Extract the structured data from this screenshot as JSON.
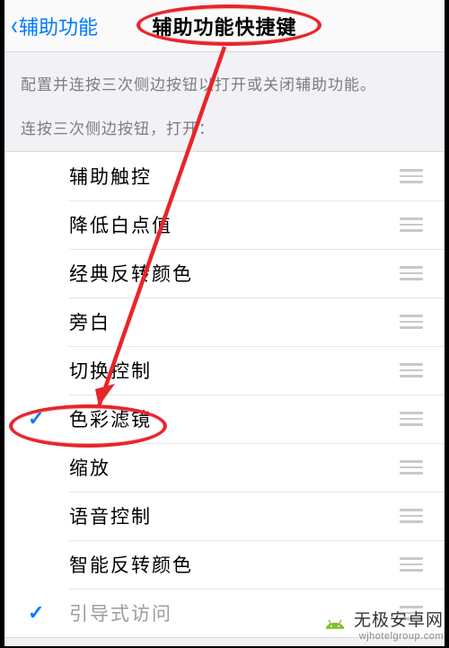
{
  "navbar": {
    "back_label": "辅助功能",
    "title": "辅助功能快捷键"
  },
  "section": {
    "intro_line1": "配置并连按三次侧边按钮以打开或关闭辅助功能。",
    "intro_line2": "连按三次侧边按钮，打开："
  },
  "items": [
    {
      "label": "辅助触控",
      "checked": false,
      "dimmed": false
    },
    {
      "label": "降低白点值",
      "checked": false,
      "dimmed": false
    },
    {
      "label": "经典反转颜色",
      "checked": false,
      "dimmed": false
    },
    {
      "label": "旁白",
      "checked": false,
      "dimmed": false
    },
    {
      "label": "切换控制",
      "checked": false,
      "dimmed": false
    },
    {
      "label": "色彩滤镜",
      "checked": true,
      "dimmed": false
    },
    {
      "label": "缩放",
      "checked": false,
      "dimmed": false
    },
    {
      "label": "语音控制",
      "checked": false,
      "dimmed": false
    },
    {
      "label": "智能反转颜色",
      "checked": false,
      "dimmed": false
    },
    {
      "label": "引导式访问",
      "checked": true,
      "dimmed": true
    }
  ],
  "watermark": {
    "brand_cn": "无极安卓网",
    "brand_en": "wjhotelgroup.com"
  },
  "annotation": {
    "color": "#e7262b",
    "highlights": [
      "title",
      "色彩滤镜"
    ]
  }
}
